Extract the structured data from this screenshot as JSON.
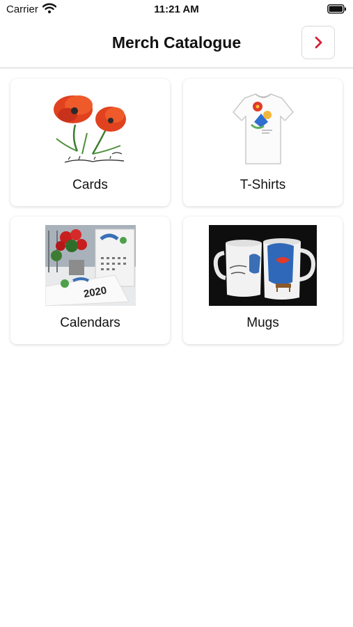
{
  "status": {
    "carrier": "Carrier",
    "time": "11:21 AM"
  },
  "nav": {
    "title": "Merch Catalogue",
    "next_icon": "chevron-right-icon",
    "accent": "#d61f37"
  },
  "categories": [
    {
      "label": "Cards",
      "image": "poppies-card-image"
    },
    {
      "label": "T-Shirts",
      "image": "t-shirt-image"
    },
    {
      "label": "Calendars",
      "image": "calendar-photo-image"
    },
    {
      "label": "Mugs",
      "image": "mugs-photo-image"
    }
  ]
}
